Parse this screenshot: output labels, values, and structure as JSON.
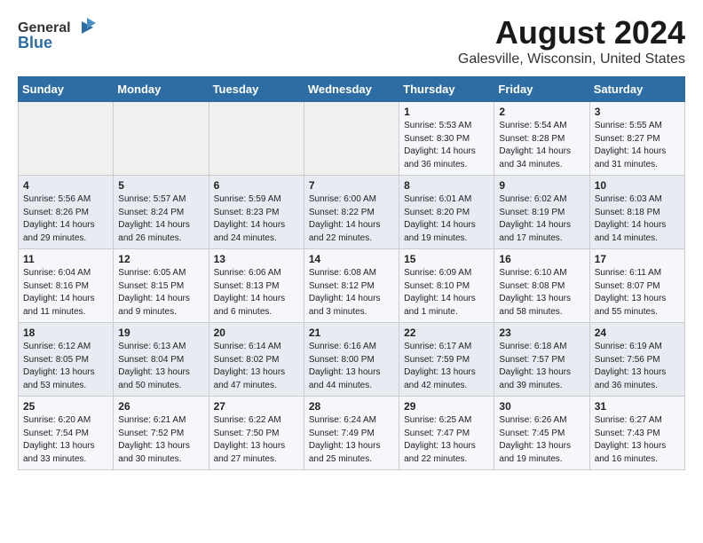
{
  "logo": {
    "general": "General",
    "blue": "Blue"
  },
  "title": "August 2024",
  "subtitle": "Galesville, Wisconsin, United States",
  "weekdays": [
    "Sunday",
    "Monday",
    "Tuesday",
    "Wednesday",
    "Thursday",
    "Friday",
    "Saturday"
  ],
  "weeks": [
    [
      {
        "day": "",
        "content": ""
      },
      {
        "day": "",
        "content": ""
      },
      {
        "day": "",
        "content": ""
      },
      {
        "day": "",
        "content": ""
      },
      {
        "day": "1",
        "content": "Sunrise: 5:53 AM\nSunset: 8:30 PM\nDaylight: 14 hours\nand 36 minutes."
      },
      {
        "day": "2",
        "content": "Sunrise: 5:54 AM\nSunset: 8:28 PM\nDaylight: 14 hours\nand 34 minutes."
      },
      {
        "day": "3",
        "content": "Sunrise: 5:55 AM\nSunset: 8:27 PM\nDaylight: 14 hours\nand 31 minutes."
      }
    ],
    [
      {
        "day": "4",
        "content": "Sunrise: 5:56 AM\nSunset: 8:26 PM\nDaylight: 14 hours\nand 29 minutes."
      },
      {
        "day": "5",
        "content": "Sunrise: 5:57 AM\nSunset: 8:24 PM\nDaylight: 14 hours\nand 26 minutes."
      },
      {
        "day": "6",
        "content": "Sunrise: 5:59 AM\nSunset: 8:23 PM\nDaylight: 14 hours\nand 24 minutes."
      },
      {
        "day": "7",
        "content": "Sunrise: 6:00 AM\nSunset: 8:22 PM\nDaylight: 14 hours\nand 22 minutes."
      },
      {
        "day": "8",
        "content": "Sunrise: 6:01 AM\nSunset: 8:20 PM\nDaylight: 14 hours\nand 19 minutes."
      },
      {
        "day": "9",
        "content": "Sunrise: 6:02 AM\nSunset: 8:19 PM\nDaylight: 14 hours\nand 17 minutes."
      },
      {
        "day": "10",
        "content": "Sunrise: 6:03 AM\nSunset: 8:18 PM\nDaylight: 14 hours\nand 14 minutes."
      }
    ],
    [
      {
        "day": "11",
        "content": "Sunrise: 6:04 AM\nSunset: 8:16 PM\nDaylight: 14 hours\nand 11 minutes."
      },
      {
        "day": "12",
        "content": "Sunrise: 6:05 AM\nSunset: 8:15 PM\nDaylight: 14 hours\nand 9 minutes."
      },
      {
        "day": "13",
        "content": "Sunrise: 6:06 AM\nSunset: 8:13 PM\nDaylight: 14 hours\nand 6 minutes."
      },
      {
        "day": "14",
        "content": "Sunrise: 6:08 AM\nSunset: 8:12 PM\nDaylight: 14 hours\nand 3 minutes."
      },
      {
        "day": "15",
        "content": "Sunrise: 6:09 AM\nSunset: 8:10 PM\nDaylight: 14 hours\nand 1 minute."
      },
      {
        "day": "16",
        "content": "Sunrise: 6:10 AM\nSunset: 8:08 PM\nDaylight: 13 hours\nand 58 minutes."
      },
      {
        "day": "17",
        "content": "Sunrise: 6:11 AM\nSunset: 8:07 PM\nDaylight: 13 hours\nand 55 minutes."
      }
    ],
    [
      {
        "day": "18",
        "content": "Sunrise: 6:12 AM\nSunset: 8:05 PM\nDaylight: 13 hours\nand 53 minutes."
      },
      {
        "day": "19",
        "content": "Sunrise: 6:13 AM\nSunset: 8:04 PM\nDaylight: 13 hours\nand 50 minutes."
      },
      {
        "day": "20",
        "content": "Sunrise: 6:14 AM\nSunset: 8:02 PM\nDaylight: 13 hours\nand 47 minutes."
      },
      {
        "day": "21",
        "content": "Sunrise: 6:16 AM\nSunset: 8:00 PM\nDaylight: 13 hours\nand 44 minutes."
      },
      {
        "day": "22",
        "content": "Sunrise: 6:17 AM\nSunset: 7:59 PM\nDaylight: 13 hours\nand 42 minutes."
      },
      {
        "day": "23",
        "content": "Sunrise: 6:18 AM\nSunset: 7:57 PM\nDaylight: 13 hours\nand 39 minutes."
      },
      {
        "day": "24",
        "content": "Sunrise: 6:19 AM\nSunset: 7:56 PM\nDaylight: 13 hours\nand 36 minutes."
      }
    ],
    [
      {
        "day": "25",
        "content": "Sunrise: 6:20 AM\nSunset: 7:54 PM\nDaylight: 13 hours\nand 33 minutes."
      },
      {
        "day": "26",
        "content": "Sunrise: 6:21 AM\nSunset: 7:52 PM\nDaylight: 13 hours\nand 30 minutes."
      },
      {
        "day": "27",
        "content": "Sunrise: 6:22 AM\nSunset: 7:50 PM\nDaylight: 13 hours\nand 27 minutes."
      },
      {
        "day": "28",
        "content": "Sunrise: 6:24 AM\nSunset: 7:49 PM\nDaylight: 13 hours\nand 25 minutes."
      },
      {
        "day": "29",
        "content": "Sunrise: 6:25 AM\nSunset: 7:47 PM\nDaylight: 13 hours\nand 22 minutes."
      },
      {
        "day": "30",
        "content": "Sunrise: 6:26 AM\nSunset: 7:45 PM\nDaylight: 13 hours\nand 19 minutes."
      },
      {
        "day": "31",
        "content": "Sunrise: 6:27 AM\nSunset: 7:43 PM\nDaylight: 13 hours\nand 16 minutes."
      }
    ]
  ]
}
